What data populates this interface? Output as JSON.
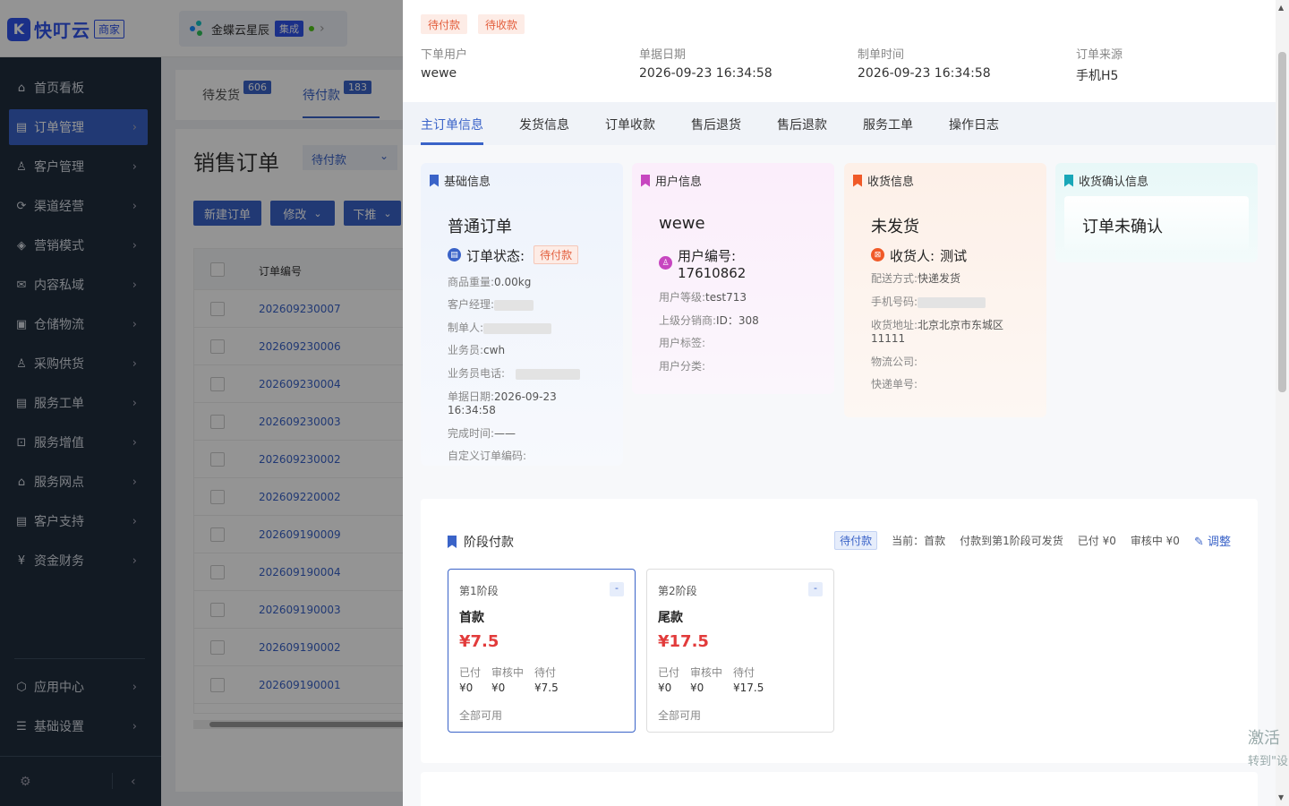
{
  "app": {
    "logo_mark": "K",
    "name": "快叮云",
    "badge": "商家",
    "tenant": "金蝶云星辰",
    "tenant_badge": "集成",
    "tenant_chevron": "›"
  },
  "sidebar": {
    "items": [
      {
        "label": "首页看板",
        "icon": "home-icon",
        "glyph": "⌂",
        "arrow": ""
      },
      {
        "label": "订单管理",
        "icon": "order-icon",
        "glyph": "▤",
        "arrow": "›"
      },
      {
        "label": "客户管理",
        "icon": "user-icon",
        "glyph": "♙",
        "arrow": "›"
      },
      {
        "label": "渠道经营",
        "icon": "channel-icon",
        "glyph": "⟳",
        "arrow": "›"
      },
      {
        "label": "营销模式",
        "icon": "tag-icon",
        "glyph": "◈",
        "arrow": "›"
      },
      {
        "label": "内容私域",
        "icon": "mail-icon",
        "glyph": "✉",
        "arrow": "›"
      },
      {
        "label": "仓储物流",
        "icon": "warehouse-icon",
        "glyph": "▣",
        "arrow": "›"
      },
      {
        "label": "采购供货",
        "icon": "purchase-icon",
        "glyph": "♙",
        "arrow": "›"
      },
      {
        "label": "服务工单",
        "icon": "ticket-icon",
        "glyph": "▤",
        "arrow": "›"
      },
      {
        "label": "服务增值",
        "icon": "lock-icon",
        "glyph": "⊡",
        "arrow": "›"
      },
      {
        "label": "服务网点",
        "icon": "shop-icon",
        "glyph": "⌂",
        "arrow": "›"
      },
      {
        "label": "客户支持",
        "icon": "support-icon",
        "glyph": "▤",
        "arrow": "›"
      },
      {
        "label": "资金财务",
        "icon": "yen-icon",
        "glyph": "¥",
        "arrow": "›"
      }
    ],
    "bottom": [
      {
        "label": "应用中心",
        "icon": "cube-icon",
        "glyph": "⬡",
        "arrow": "›"
      },
      {
        "label": "基础设置",
        "icon": "settings-list-icon",
        "glyph": "☰",
        "arrow": "›"
      }
    ],
    "footer_gear": "⚙",
    "footer_collapse": "‹"
  },
  "orders_page": {
    "tabs": [
      {
        "label": "待发货",
        "count": "606"
      },
      {
        "label": "待付款",
        "count": "183"
      }
    ],
    "title": "销售订单",
    "status_select": "待付款",
    "select_caret": "⌄",
    "buttons": {
      "new": "新建订单",
      "edit": "修改",
      "push": "下推"
    },
    "column_order_no": "订单编号",
    "rows": [
      "202609230007",
      "202609230006",
      "202609230004",
      "202609230003",
      "202609230002",
      "202609220002",
      "202609190009",
      "202609190004",
      "202609190003",
      "202609190002",
      "202609190001"
    ]
  },
  "drawer": {
    "status_tags": [
      "待付款",
      "待收款"
    ],
    "meta": [
      {
        "label": "下单用户",
        "value": "wewe"
      },
      {
        "label": "单据日期",
        "value": "2026-09-23 16:34:58"
      },
      {
        "label": "制单时间",
        "value": "2026-09-23 16:34:58"
      },
      {
        "label": "订单来源",
        "value": "手机H5"
      }
    ],
    "tabs": [
      "主订单信息",
      "发货信息",
      "订单收款",
      "售后退货",
      "售后退款",
      "服务工单",
      "操作日志"
    ],
    "basic": {
      "title": "基础信息",
      "type": "普通订单",
      "status_label": "订单状态:",
      "status_value": "待付款",
      "weight_label": "商品重量:",
      "weight": "0.00kg",
      "manager_label": "客户经理:",
      "maker_label": "制单人:",
      "sales_label": "业务员:",
      "sales": "cwh",
      "phone_label": "业务员电话:",
      "date_label": "单据日期:",
      "date": "2026-09-23",
      "date_time": "16:34:58",
      "finish_label": "完成时间:",
      "finish": "——",
      "custom_label": "自定义订单编码:"
    },
    "user": {
      "title": "用户信息",
      "name": "wewe",
      "no_label": "用户编号:",
      "no": "17610862",
      "level_label": "用户等级:",
      "level": "test713",
      "parent_label": "上级分销商:",
      "parent": "ID：308",
      "tag_label": "用户标签:",
      "cat_label": "用户分类:"
    },
    "receive": {
      "title": "收货信息",
      "status": "未发货",
      "receiver_label": "收货人:",
      "receiver": "测试",
      "ship_label": "配送方式:",
      "ship": "快递发货",
      "phone_label": "手机号码:",
      "addr_label": "收货地址:",
      "addr": "北京北京市东城区",
      "addr2": "11111",
      "logistics_label": "物流公司:",
      "tracking_label": "快递单号:"
    },
    "confirm": {
      "title": "收货确认信息",
      "text": "订单未确认"
    },
    "payment": {
      "title": "阶段付款",
      "tag": "待付款",
      "current": "当前：首款",
      "rule": "付款到第1阶段可发货",
      "paid": "已付 ¥0",
      "reviewing": "审核中 ¥0",
      "adjust": "调整",
      "stages": [
        {
          "name": "第1阶段",
          "type": "首款",
          "amount": "¥7.5",
          "paid_label": "已付",
          "paid": "¥0",
          "review_label": "审核中",
          "review": "¥0",
          "pending_label": "待付",
          "pending": "¥7.5",
          "avail": "全部可用",
          "toggle": "-"
        },
        {
          "name": "第2阶段",
          "type": "尾款",
          "amount": "¥17.5",
          "paid_label": "已付",
          "paid": "¥0",
          "review_label": "审核中",
          "review": "¥0",
          "pending_label": "待付",
          "pending": "¥17.5",
          "avail": "全部可用",
          "toggle": "-"
        }
      ]
    }
  },
  "watermark": {
    "line1": "激活",
    "line2": "转到\"设"
  },
  "colors": {
    "primary": "#3a63c8",
    "sidebar": "#1f2d3d",
    "danger": "#e23b3b",
    "warn": "#e35f3e"
  }
}
